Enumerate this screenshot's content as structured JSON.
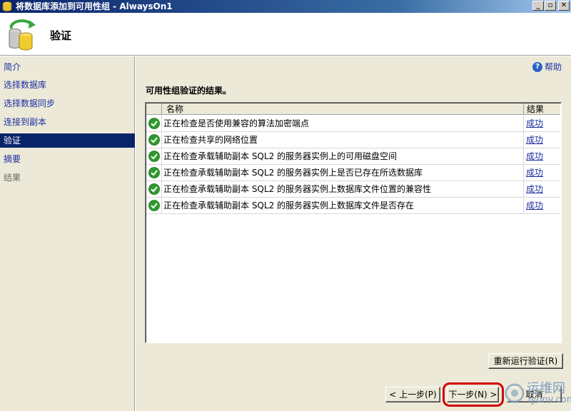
{
  "window": {
    "title": "将数据库添加到可用性组 - AlwaysOn1",
    "controls": {
      "minimize": "_",
      "restore": "▫",
      "close": "✕"
    }
  },
  "header": {
    "heading": "验证"
  },
  "nav": {
    "items": [
      {
        "label": "简介",
        "state": "link"
      },
      {
        "label": "选择数据库",
        "state": "link"
      },
      {
        "label": "选择数据同步",
        "state": "link"
      },
      {
        "label": "连接到副本",
        "state": "link"
      },
      {
        "label": "验证",
        "state": "active"
      },
      {
        "label": "摘要",
        "state": "link"
      },
      {
        "label": "结果",
        "state": "disabled"
      }
    ]
  },
  "help": {
    "label": "帮助",
    "icon": "help-icon"
  },
  "main": {
    "section_title": "可用性组验证的结果。",
    "columns": {
      "name": "名称",
      "result": "结果"
    },
    "rows": [
      {
        "name": "正在检查是否使用兼容的算法加密端点",
        "result": "成功",
        "status_icon": "success-check-icon"
      },
      {
        "name": "正在检查共享的网络位置",
        "result": "成功",
        "status_icon": "success-check-icon"
      },
      {
        "name": "正在检查承载辅助副本 SQL2 的服务器实例上的可用磁盘空间",
        "result": "成功",
        "status_icon": "success-check-icon"
      },
      {
        "name": "正在检查承载辅助副本 SQL2 的服务器实例上是否已存在所选数据库",
        "result": "成功",
        "status_icon": "success-check-icon"
      },
      {
        "name": "正在检查承载辅助副本 SQL2 的服务器实例上数据库文件位置的兼容性",
        "result": "成功",
        "status_icon": "success-check-icon"
      },
      {
        "name": "正在检查承载辅助副本 SQL2 的服务器实例上数据库文件是否存在",
        "result": "成功",
        "status_icon": "success-check-icon"
      }
    ],
    "rerun_label": "重新运行验证(R)"
  },
  "footer": {
    "prev_label": "< 上一步(P)",
    "next_label": "下一步(N) >",
    "cancel_label": "取消"
  },
  "watermark": {
    "text1": "运维网",
    "text2": "iyunv.com"
  },
  "colors": {
    "accent": "#0a246a",
    "link": "#1a2ea0",
    "success": "#2e9a2e",
    "highlight": "#d00000"
  }
}
